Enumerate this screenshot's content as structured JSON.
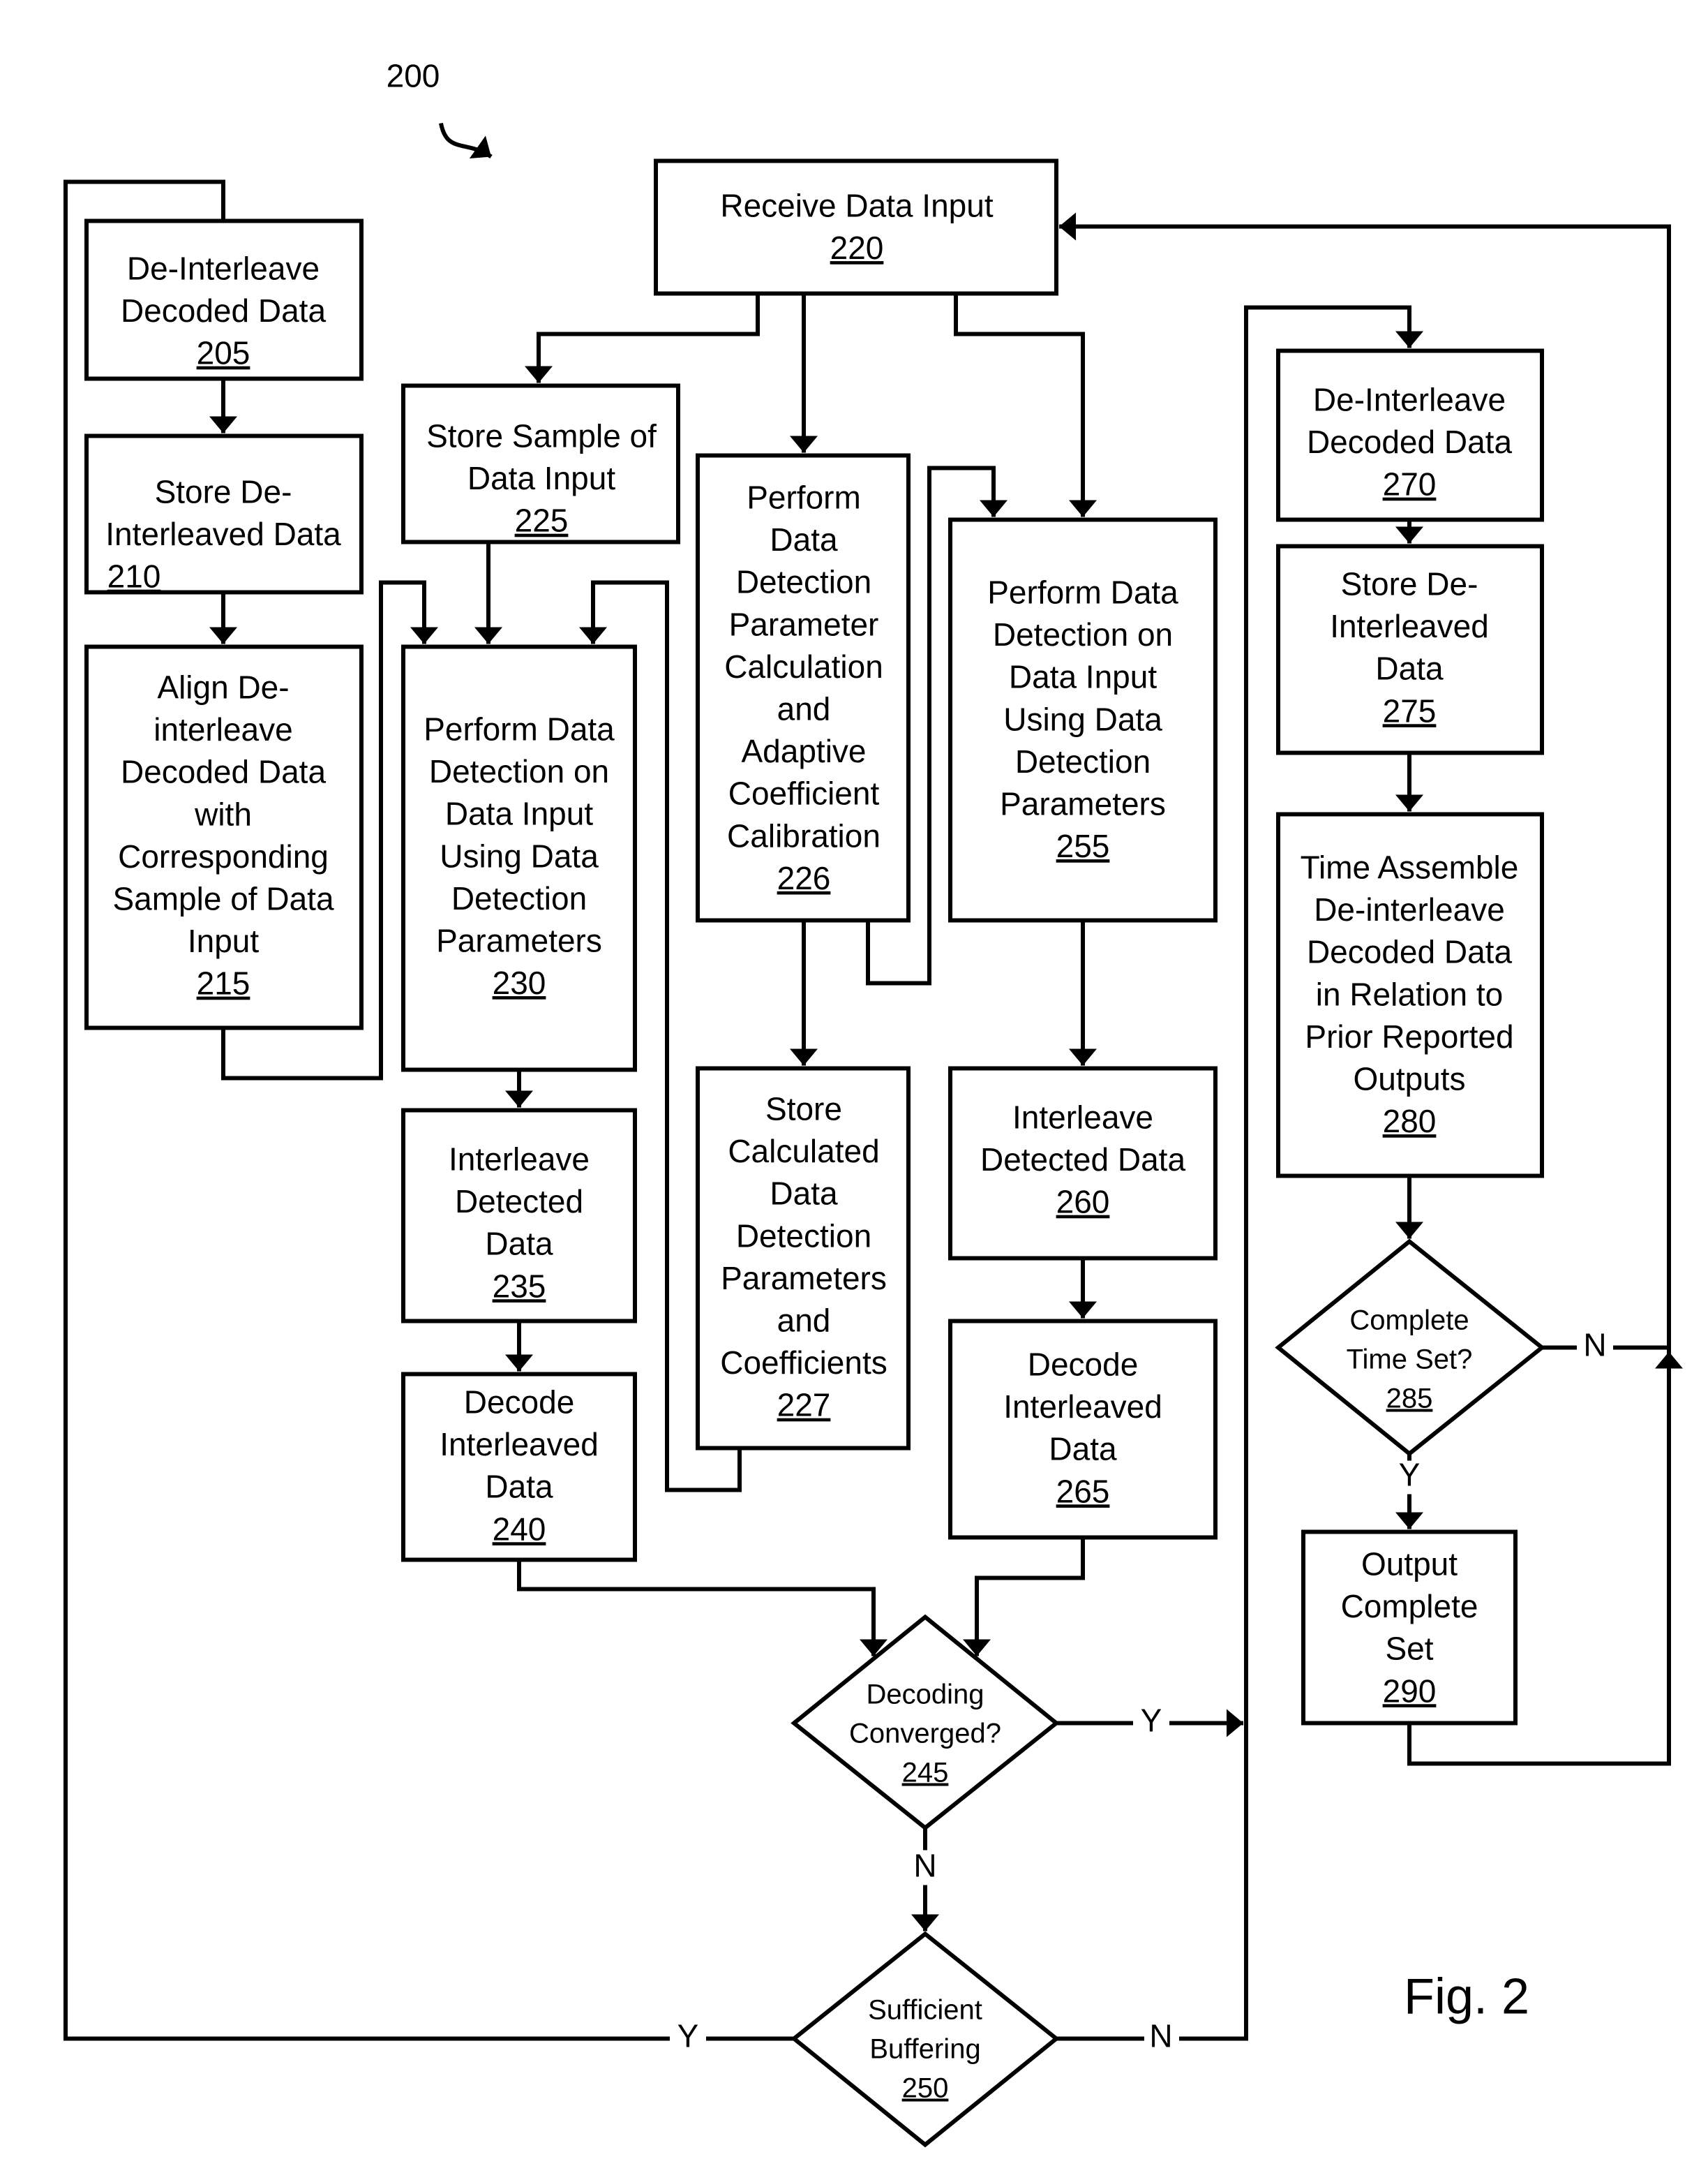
{
  "figure": {
    "reference_numeral": "200",
    "caption": "Fig. 2"
  },
  "nodes": {
    "n205": {
      "lines": [
        "De-Interleave",
        "Decoded Data"
      ],
      "ref": "205"
    },
    "n210": {
      "lines": [
        "Store De-",
        "Interleaved Data"
      ],
      "ref": "210"
    },
    "n215": {
      "lines": [
        "Align De-",
        "interleave",
        "Decoded Data",
        "with",
        "Corresponding",
        "Sample of Data",
        "Input"
      ],
      "ref": "215"
    },
    "n220": {
      "lines": [
        "Receive Data Input"
      ],
      "ref": "220"
    },
    "n225": {
      "lines": [
        "Store Sample of",
        "Data Input"
      ],
      "ref": "225"
    },
    "n226": {
      "lines": [
        "Perform",
        "Data",
        "Detection",
        "Parameter",
        "Calculation",
        "and",
        "Adaptive",
        "Coefficient",
        "Calibration"
      ],
      "ref": "226"
    },
    "n227": {
      "lines": [
        "Store",
        "Calculated",
        "Data",
        "Detection",
        "Parameters",
        "and",
        "Coefficients"
      ],
      "ref": "227"
    },
    "n230": {
      "lines": [
        "Perform Data",
        "Detection on",
        "Data Input",
        "Using Data",
        "Detection",
        "Parameters"
      ],
      "ref": "230"
    },
    "n235": {
      "lines": [
        "Interleave",
        "Detected",
        "Data"
      ],
      "ref": "235"
    },
    "n240": {
      "lines": [
        "Decode",
        "Interleaved",
        "Data"
      ],
      "ref": "240"
    },
    "n245": {
      "lines": [
        "Decoding",
        "Converged?"
      ],
      "ref": "245"
    },
    "n250": {
      "lines": [
        "Sufficient",
        "Buffering"
      ],
      "ref": "250"
    },
    "n255": {
      "lines": [
        "Perform Data",
        "Detection on",
        "Data Input",
        "Using Data",
        "Detection",
        "Parameters"
      ],
      "ref": "255"
    },
    "n260": {
      "lines": [
        "Interleave",
        "Detected Data"
      ],
      "ref": "260"
    },
    "n265": {
      "lines": [
        "Decode",
        "Interleaved",
        "Data"
      ],
      "ref": "265"
    },
    "n270": {
      "lines": [
        "De-Interleave",
        "Decoded Data"
      ],
      "ref": "270"
    },
    "n275": {
      "lines": [
        "Store De-",
        "Interleaved",
        "Data"
      ],
      "ref": "275"
    },
    "n280": {
      "lines": [
        "Time Assemble",
        "De-interleave",
        "Decoded Data",
        "in Relation to",
        "Prior Reported",
        "Outputs"
      ],
      "ref": "280"
    },
    "n285": {
      "lines": [
        "Complete",
        "Time Set?"
      ],
      "ref": "285"
    },
    "n290": {
      "lines": [
        "Output",
        "Complete",
        "Set"
      ],
      "ref": "290"
    }
  },
  "edge_labels": {
    "e245_yes": "Y",
    "e245_no": "N",
    "e250_yes": "Y",
    "e250_no": "N",
    "e285_no": "N",
    "e285_yes": "Y"
  }
}
